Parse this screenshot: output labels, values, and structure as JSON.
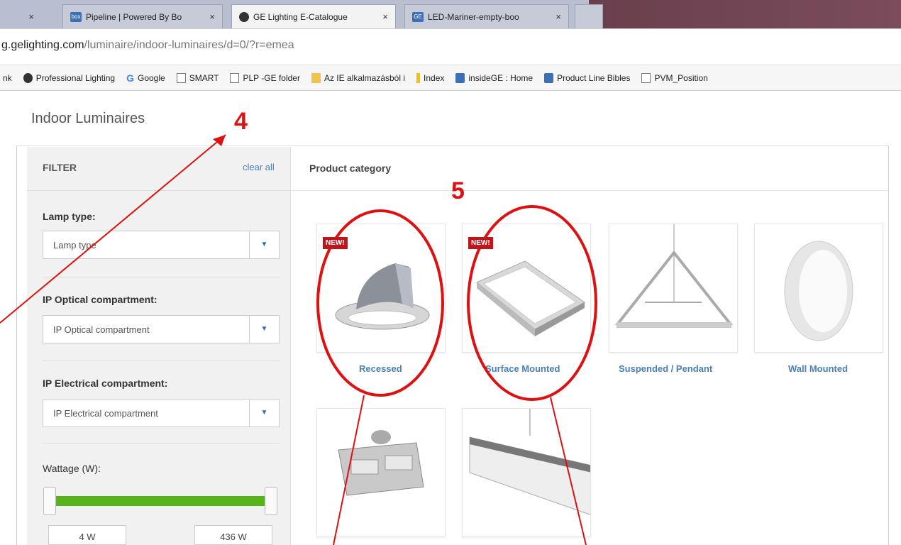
{
  "browser": {
    "tabs": [
      {
        "title": "Pipeline | Powered By Bo"
      },
      {
        "title": "GE Lighting E-Catalogue"
      },
      {
        "title": "LED-Mariner-empty-boo"
      }
    ],
    "tab_close": "×",
    "address": {
      "host": "g.gelighting.com",
      "path": "/luminaire/indoor-luminaires/d=0/?r=emea"
    },
    "bookmarks": [
      {
        "label": "nk",
        "icon": "none"
      },
      {
        "label": "Professional Lighting",
        "icon": "ge-logo"
      },
      {
        "label": "Google",
        "icon": "google"
      },
      {
        "label": "SMART",
        "icon": "page"
      },
      {
        "label": "PLP -GE folder",
        "icon": "page"
      },
      {
        "label": "Az IE alkalmazásból i",
        "icon": "folder"
      },
      {
        "label": "Index",
        "icon": "index"
      },
      {
        "label": "insideGE : Home",
        "icon": "ge-box"
      },
      {
        "label": "Product Line Bibles",
        "icon": "link"
      },
      {
        "label": "PVM_Position",
        "icon": "page"
      }
    ]
  },
  "page": {
    "title": "Indoor Luminaires",
    "filter_label": "FILTER",
    "clear_all": "clear all",
    "product_category_label": "Product category"
  },
  "filters": {
    "lamp_type": {
      "label": "Lamp type:",
      "value": "Lamp type"
    },
    "ip_optical": {
      "label": "IP Optical compartment:",
      "value": "IP Optical compartment"
    },
    "ip_electrical": {
      "label": "IP Electrical compartment:",
      "value": "IP Electrical compartment"
    },
    "wattage": {
      "label": "Wattage (W):",
      "min": "4 W",
      "max": "436 W",
      "slider_fill": 1.0
    }
  },
  "categories": [
    {
      "label": "Recessed",
      "badge": "NEW!"
    },
    {
      "label": "Surface Mounted",
      "badge": "NEW!"
    },
    {
      "label": "Suspended / Pendant"
    },
    {
      "label": "Wall Mounted"
    },
    {
      "label": ""
    },
    {
      "label": ""
    }
  ],
  "annotations": {
    "number_4": "4",
    "number_5": "5"
  },
  "colors": {
    "annotation_red": "#dd1111",
    "link_blue": "#4a7fb7",
    "slider_green": "#56b41a",
    "badge_red": "#c0141b"
  }
}
